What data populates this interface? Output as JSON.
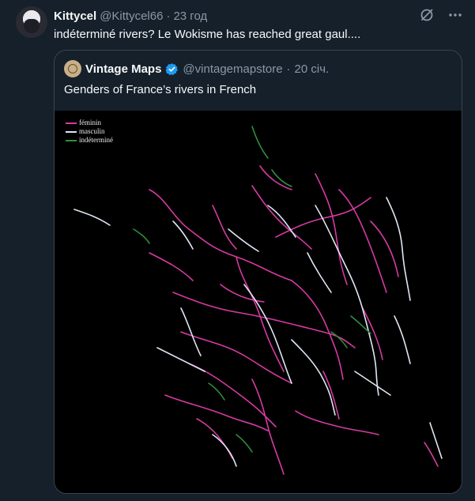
{
  "author": {
    "name": "Kittycel",
    "handle": "@Kittycel66",
    "separator": "·",
    "time": "23 год"
  },
  "tweet": {
    "text": "indéterminé rivers? Le Wokisme has reached great gaul...."
  },
  "icons": {
    "grok": "slashed-circle-icon",
    "more": "more-dots-icon",
    "verified": "verified-badge-icon"
  },
  "quote": {
    "name": "Vintage Maps",
    "handle": "@vintagemapstore",
    "separator": "·",
    "time": "20 січ.",
    "text": "Genders of France’s rivers in French"
  },
  "map": {
    "legend": [
      {
        "label": "féminin",
        "color": "#d63aa2"
      },
      {
        "label": "masculin",
        "color": "#dfe6f5"
      },
      {
        "label": "indéterminé",
        "color": "#2f8f3a"
      }
    ]
  },
  "colors": {
    "background": "#15202b",
    "border": "#38444d",
    "muted": "#8b98a5",
    "verified": "#1d9bf0",
    "feminine": "#d63aa2",
    "masculine": "#dfe6f5",
    "indeterminate": "#2f8f3a"
  }
}
